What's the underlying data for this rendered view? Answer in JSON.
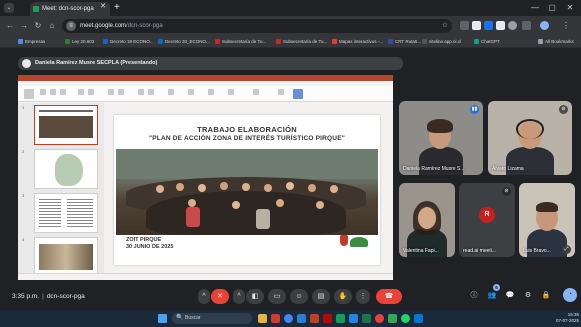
{
  "browser": {
    "tab_title": "Meet: dcn-scor-pga",
    "tab_close": "✕",
    "new_tab": "+",
    "url_domain": "meet.google.com",
    "url_path": "/dcn-scor-pga",
    "window_controls": [
      "⌄",
      "—",
      "▢",
      "✕"
    ],
    "bookmarks": [
      {
        "label": "Empresas",
        "color": "#4a90e2"
      },
      {
        "label": "Ley 20.603",
        "color": "#2e7d32"
      },
      {
        "label": "Decreto 19 ECONO...",
        "color": "#1565c0"
      },
      {
        "label": "Decreto 30_ECONO...",
        "color": "#1565c0"
      },
      {
        "label": "Subsecretaría de Tu...",
        "color": "#c62828"
      },
      {
        "label": "Subsecretaría de Tu...",
        "color": "#c62828"
      },
      {
        "label": "Mapas interactivos -...",
        "color": "#e53935"
      },
      {
        "label": "CRT Ruta5...",
        "color": "#3949ab"
      },
      {
        "label": "siteline.app.oi.cl",
        "color": "#555555"
      },
      {
        "label": "ChatGPT",
        "color": "#10a37f"
      },
      {
        "label": "All Bookmarks",
        "color": "#9aa0a6"
      }
    ]
  },
  "presenter": {
    "label": "Daniela Ramírez Musre SECPLA (Presentando)"
  },
  "slide": {
    "title_line1": "TRABAJO ELABORACIÓN",
    "title_line2": "\"PLAN DE ACCIÓN ZONA DE INTERÉS TURÍSTICO PIRQUE\"",
    "footer_line1": "ZOIT PIRQUE",
    "footer_line2": "30 JUNIO DE 2025",
    "thumb_numbers": [
      "1",
      "2",
      "3",
      "4"
    ]
  },
  "participants": [
    {
      "name": "Daniela Ramírez Musre S...",
      "muted": false
    },
    {
      "name": "Álvaro Lizama",
      "muted": true
    },
    {
      "name": "Valentina Fapi...",
      "muted": false
    },
    {
      "name": "read.ai meeti...",
      "muted": true,
      "initial": "R"
    },
    {
      "name": "Luis Bravo...",
      "muted": false
    }
  ],
  "meeting": {
    "time": "3:35 p.m.",
    "separator": "|",
    "code": "dcn-scor-pga",
    "participant_count": "6"
  },
  "controls": {
    "reactions": "^",
    "mic": "🎤",
    "camera_menu": "^",
    "present": "▭",
    "emoji": "☺",
    "captions": "▤",
    "raise_hand": "✋",
    "more": "⋮",
    "leave": "☎",
    "info": "ⓘ",
    "people": "👥",
    "chat": "💬",
    "activities": "⚙",
    "lock": "🔒",
    "activity_fab": "◔"
  },
  "taskbar": {
    "search_placeholder": "Buscar",
    "search_icon": "🔍",
    "time": "15:35",
    "date": "07-07-2025"
  },
  "colors": {
    "leave_red": "#ea4335",
    "accent_blue": "#8ab4f8",
    "ppt_orange": "#b7472a"
  }
}
